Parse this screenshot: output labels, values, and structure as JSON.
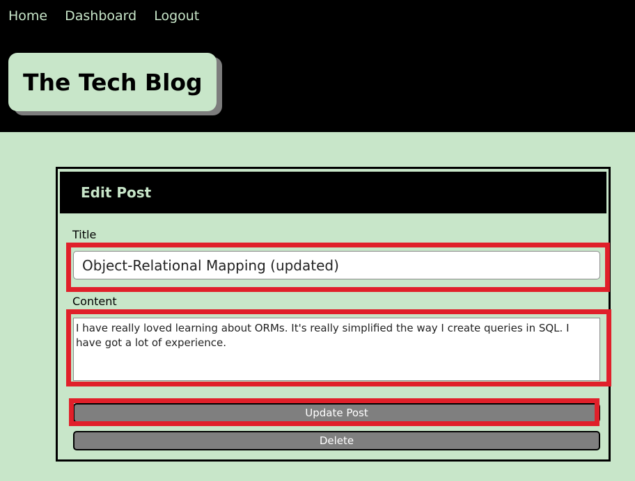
{
  "nav": {
    "items": [
      {
        "label": "Home"
      },
      {
        "label": "Dashboard"
      },
      {
        "label": "Logout"
      }
    ]
  },
  "header": {
    "title": "The Tech Blog"
  },
  "edit_post": {
    "heading": "Edit Post",
    "title_label": "Title",
    "title_value": "Object-Relational Mapping (updated)",
    "content_label": "Content",
    "content_value": "I have really loved learning about ORMs. It's really simplified the way I create queries in SQL. I have got a lot of experience.",
    "update_button": "Update Post",
    "delete_button": "Delete"
  },
  "colors": {
    "background": "#c8e6c9",
    "header_bg": "#000000",
    "button_bg": "#7f7f7f",
    "highlight": "#e0202a"
  }
}
